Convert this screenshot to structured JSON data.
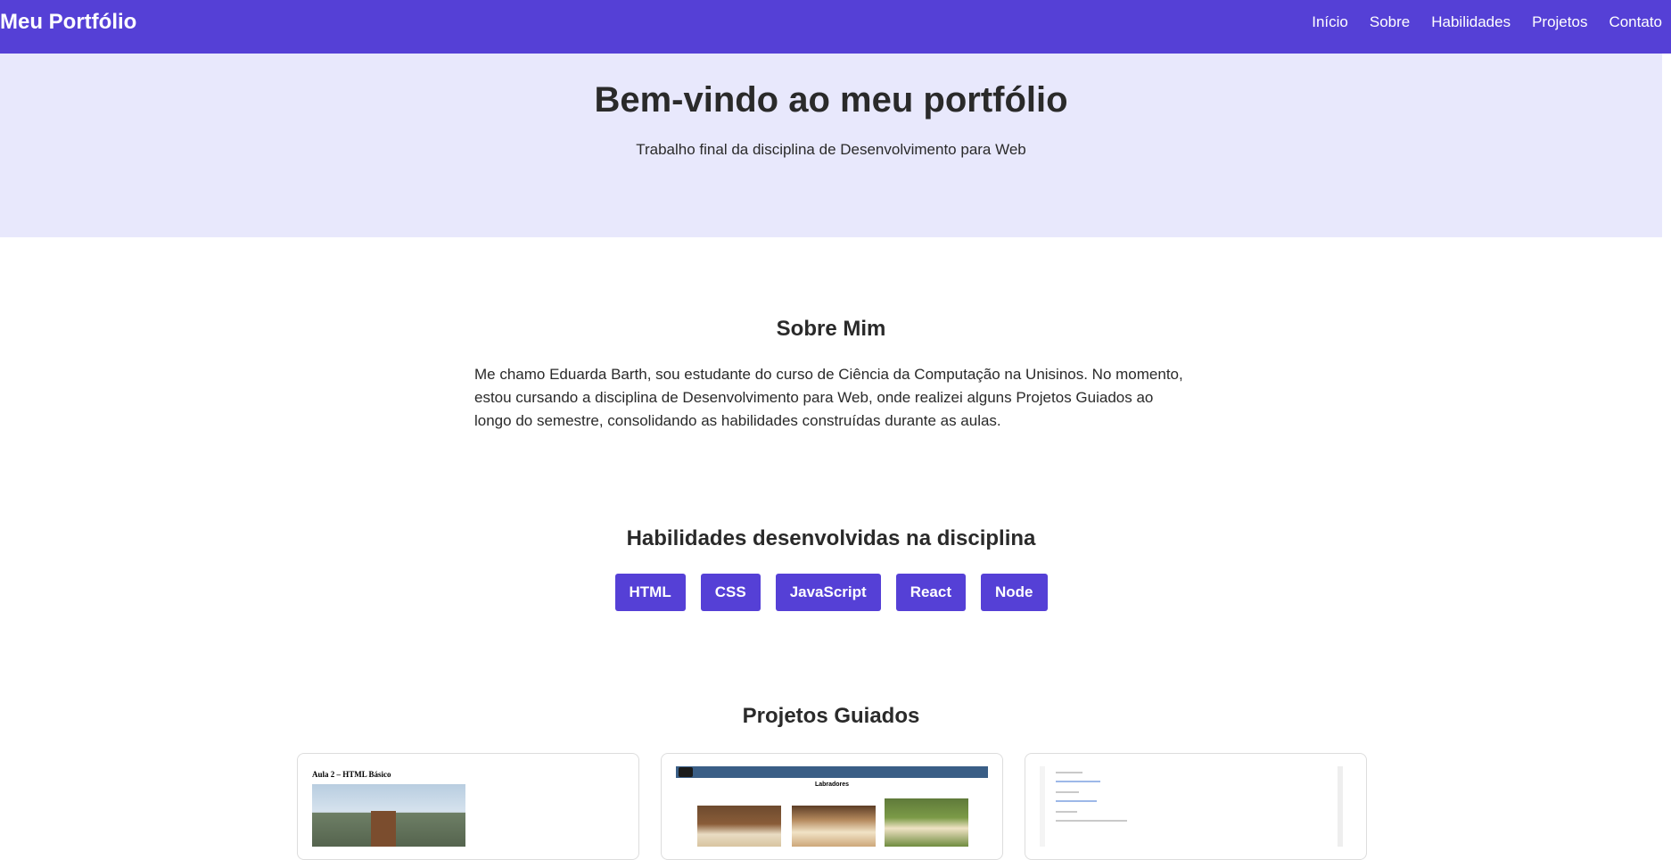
{
  "navbar": {
    "brand": "Meu Portfólio",
    "links": [
      "Início",
      "Sobre",
      "Habilidades",
      "Projetos",
      "Contato"
    ]
  },
  "hero": {
    "title": "Bem-vindo ao meu portfólio",
    "subtitle": "Trabalho final da disciplina de Desenvolvimento para Web"
  },
  "about": {
    "title": "Sobre Mim",
    "text": "Me chamo Eduarda Barth, sou estudante do curso de Ciência da Computação na Unisinos. No momento, estou cursando a disciplina de Desenvolvimento para Web, onde realizei alguns Projetos Guiados ao longo do semestre, consolidando as habilidades construídas durante as aulas."
  },
  "skills": {
    "title": "Habilidades desenvolvidas na disciplina",
    "items": [
      "HTML",
      "CSS",
      "JavaScript",
      "React",
      "Node"
    ]
  },
  "projects": {
    "title": "Projetos Guiados",
    "card1_thumb_title": "Aula 2 – HTML Básico",
    "card2_thumb_title": "Labradores"
  },
  "colors": {
    "accent": "#5540d6",
    "hero_bg": "#e8e8fc"
  }
}
